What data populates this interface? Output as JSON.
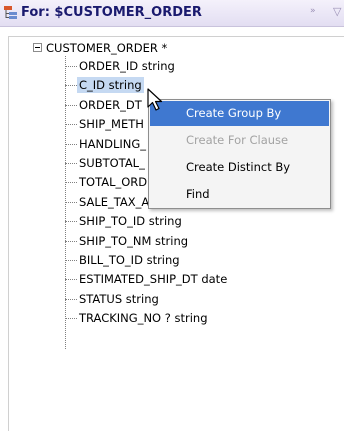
{
  "header": {
    "title": "For: $CUSTOMER_ORDER",
    "icon": "xml-element-icon",
    "collapse_glyph": "»",
    "menu_glyph": "▽"
  },
  "tree": {
    "root": {
      "label": "CUSTOMER_ORDER *",
      "expanded": true
    },
    "children": [
      "ORDER_ID string",
      "C_ID string",
      "ORDER_DT",
      "SHIP_METH",
      "HANDLING_",
      "SUBTOTAL_",
      "TOTAL_ORDER_AMT decimal",
      "SALE_TAX_AMT decimal",
      "SHIP_TO_ID string",
      "SHIP_TO_NM string",
      "BILL_TO_ID string",
      "ESTIMATED_SHIP_DT date",
      "STATUS string",
      "TRACKING_NO ? string"
    ],
    "selected": "C_ID string"
  },
  "context_menu": {
    "items": [
      {
        "label": "Create Group By",
        "state": "hover"
      },
      {
        "label": "Create For Clause",
        "state": "disabled"
      },
      {
        "label": "Create Distinct By",
        "state": "enabled"
      },
      {
        "label": "Find",
        "state": "enabled"
      }
    ]
  },
  "colors": {
    "selection": "#c5d9f2",
    "menu_hover": "#3f78d0",
    "header_title": "#1a1a6e"
  }
}
